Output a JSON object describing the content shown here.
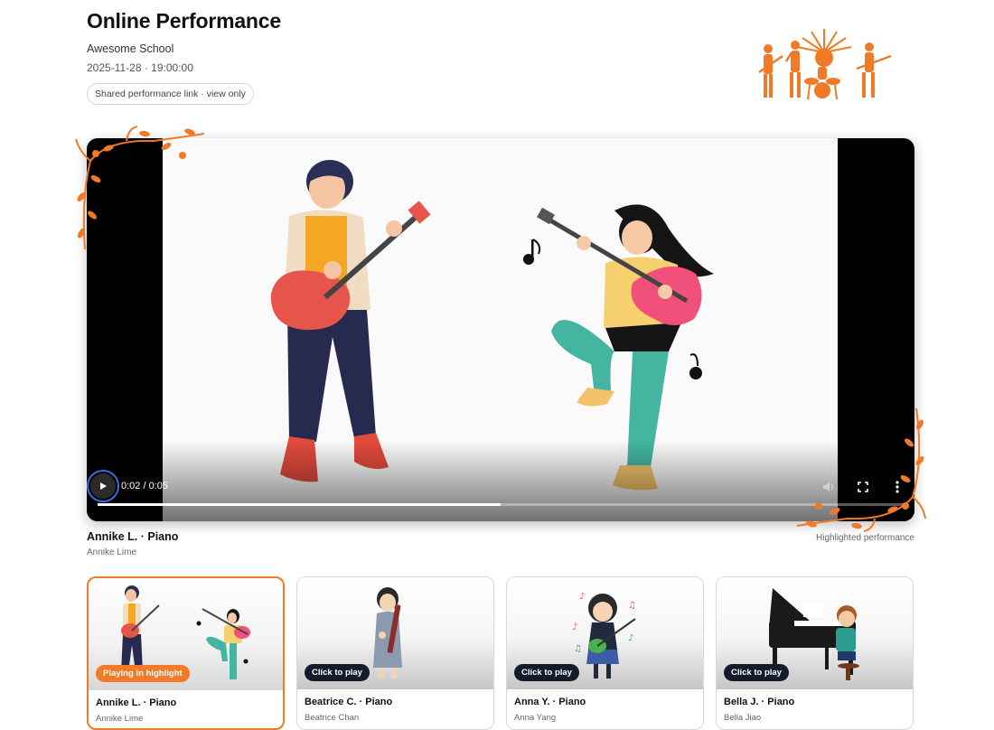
{
  "header": {
    "title": "Online Performance",
    "school": "Awesome School",
    "datetime": "2025-11-28 · 19:00:00",
    "share_chip": "Shared performance link · view only"
  },
  "player": {
    "time_readout": "0:02 / 0:05",
    "progress": 0.5,
    "controls": [
      "play-icon",
      "volume-icon",
      "fullscreen-icon",
      "more-options-icon"
    ]
  },
  "now_playing": {
    "title": "Annike L. · Piano",
    "performer": "Annike Lime",
    "highlight_note": "Highlighted performance"
  },
  "cards": [
    {
      "title": "Annike L. · Piano",
      "performer": "Annike Lime",
      "badge": "Playing in highlight",
      "active": true
    },
    {
      "title": "Beatrice C. · Piano",
      "performer": "Beatrice Chan",
      "badge": "Click to play",
      "active": false
    },
    {
      "title": "Anna Y. · Piano",
      "performer": "Anna Yang",
      "badge": "Click to play",
      "active": false
    },
    {
      "title": "Bella J. · Piano",
      "performer": "Bella Jiao",
      "badge": "Click to play",
      "active": false
    }
  ],
  "colors": {
    "accent": "#f07a25",
    "badge_dark": "#141c2b",
    "player_bg": "#000000"
  }
}
